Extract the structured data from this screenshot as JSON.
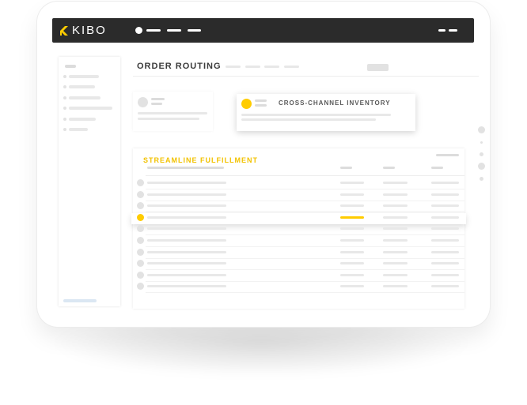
{
  "app": {
    "logo_text": "KIBO",
    "brand_color": "#ffcc00",
    "topbar_color": "#2b2b2b"
  },
  "header": {
    "title": "ORDER ROUTING"
  },
  "card": {
    "title": "CROSS-CHANNEL INVENTORY"
  },
  "table": {
    "title": "STREAMLINE FULFILLMENT",
    "title_color": "#f2c200",
    "row_count": 10,
    "selected_row_index": 3
  },
  "icons": {
    "logo": "kibo-logo-icon",
    "nav_dot": "status-dot-icon"
  }
}
